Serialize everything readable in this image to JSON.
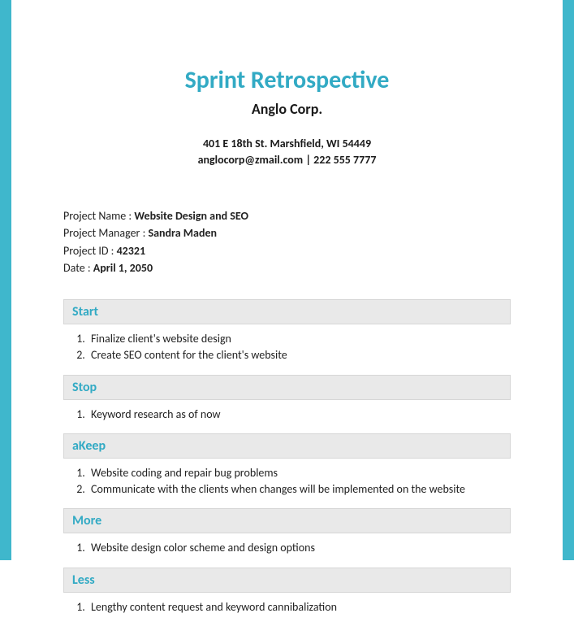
{
  "header": {
    "title": "Sprint Retrospective",
    "company": "Anglo Corp.",
    "address": "401 E 18th St. Marshfield, WI 54449",
    "contact": "anglocorp@zmail.com | 222 555 7777"
  },
  "meta": {
    "project_name_label": "Project Name : ",
    "project_name": "Website Design and SEO",
    "project_manager_label": "Project Manager : ",
    "project_manager": "Sandra Maden",
    "project_id_label": "Project ID : ",
    "project_id": "42321",
    "date_label": "Date : ",
    "date": "April 1, 2050"
  },
  "sections": {
    "start": {
      "heading": "Start",
      "items": [
        "Finalize client's website design",
        "Create SEO content for the client's website"
      ]
    },
    "stop": {
      "heading": "Stop",
      "items": [
        "Keyword research as of now"
      ]
    },
    "keep": {
      "heading": "aKeep",
      "items": [
        "Website coding and repair bug problems",
        "Communicate with the clients when changes will be implemented on the website"
      ]
    },
    "more": {
      "heading": "More",
      "items": [
        "Website design color scheme and design options"
      ]
    },
    "less": {
      "heading": "Less",
      "items": [
        "Lengthy content request and keyword cannibalization"
      ]
    }
  }
}
